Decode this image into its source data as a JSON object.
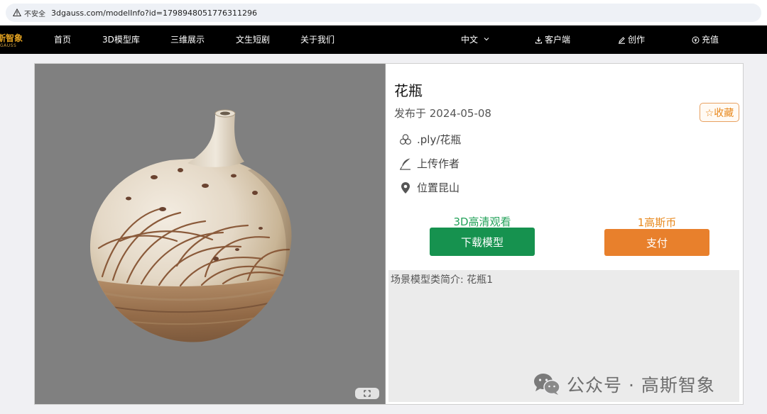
{
  "browser": {
    "security_label": "不安全",
    "url": "3dgauss.com/modelInfo?id=1798948051776311296"
  },
  "nav": {
    "logo_cn": "斯智象",
    "logo_en": "GAUSS",
    "items": [
      "首页",
      "3D模型库",
      "三维展示",
      "文生短剧",
      "关于我们"
    ],
    "language": "中文",
    "client": "客户端",
    "create": "创作",
    "recharge": "充值"
  },
  "model": {
    "title": "花瓶",
    "published": "发布于 2024-05-08",
    "favorite_label": "☆收藏",
    "format": ".ply/花瓶",
    "author": "上传作者",
    "location": "位置昆山",
    "view_label": "3D高清观看",
    "download_label": "下载模型",
    "price_label": "1高斯币",
    "pay_label": "支付",
    "description": "场景模型类简介: 花瓶1"
  },
  "watermark": {
    "text": "公众号 · 高斯智象"
  },
  "colors": {
    "nav_bg": "#000000",
    "download_green": "#16924f",
    "pay_orange": "#e8802c",
    "accent_orange": "#e8881c"
  }
}
